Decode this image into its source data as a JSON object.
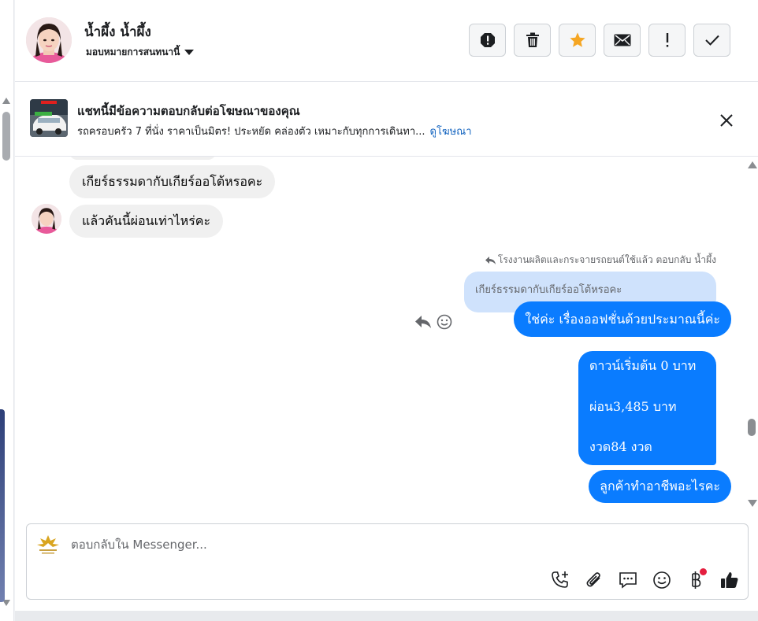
{
  "header": {
    "contact_name": "น้ำผึ้ง น้ำผึ้ง",
    "assign_label": "มอบหมายการสนทนานี้",
    "actions": [
      {
        "name": "spam-button",
        "icon": "alert-octagon-icon"
      },
      {
        "name": "delete-button",
        "icon": "trash-icon"
      },
      {
        "name": "star-button",
        "icon": "star-icon"
      },
      {
        "name": "mark-unread-button",
        "icon": "envelope-icon"
      },
      {
        "name": "follow-up-button",
        "icon": "exclamation-icon"
      },
      {
        "name": "done-button",
        "icon": "check-icon"
      }
    ],
    "star_color": "#f5a623"
  },
  "ad_banner": {
    "title": "แชทนี้มีข้อความตอบกลับต่อโฆษณาของคุณ",
    "description": "รถครอบครัว 7 ที่นั่ง ราคาเป็นมิตร! ประหยัด คล่องตัว เหมาะกับทุกการเดินทา...",
    "link_label": "ดูโฆษณา"
  },
  "messages": {
    "incoming": [
      "เกียร์ธรรมดากับเกียร์ออโต้หรอคะ",
      "แล้วคันนี้ผ่อนเท่าไหร่คะ"
    ],
    "reply_note": "โรงงานผลิตและกระจายรถยนต์ใช้แล้ว ตอบกลับ น้ำผึ้ง",
    "quoted_text": "เกียร์ธรรมดากับเกียร์ออโต้หรอคะ",
    "reply_text": "ใช่ค่ะ เรื่องออฟชั่นด้วยประมาณนี้ค่ะ",
    "quote_lines": [
      "ดาวน์เริ่มต้น 0 บาท",
      "ผ่อน3,485 บาท",
      "งวด84 งวด"
    ],
    "last_outgoing": "ลูกค้าทำอาชีพอะไรคะ"
  },
  "composer": {
    "placeholder": "ตอบกลับใน Messenger...",
    "tools": [
      "phone-plus-icon",
      "paperclip-icon",
      "chat-bubble-icon",
      "smiley-icon",
      "baht-icon",
      "thumbs-up-icon"
    ]
  },
  "colors": {
    "outgoing_bubble": "#0a7cff",
    "incoming_bubble": "#f0f0f0",
    "quoted_bubble": "#cfe2fc",
    "link": "#1565c0",
    "notification_dot": "#e41e3f"
  }
}
